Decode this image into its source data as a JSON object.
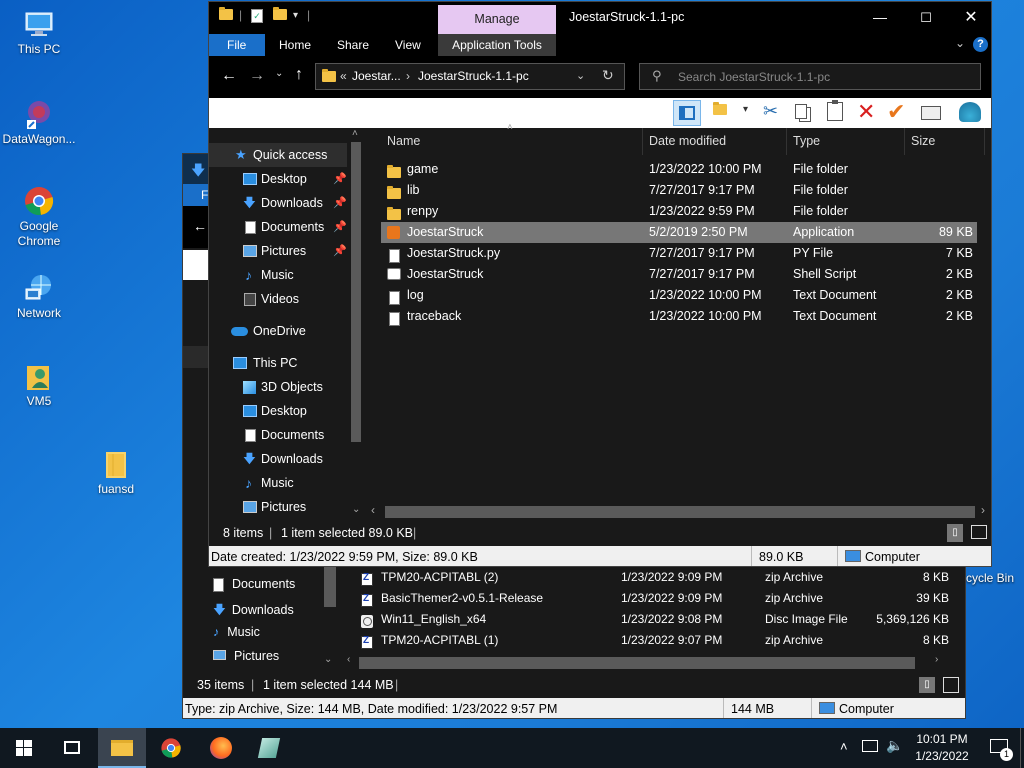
{
  "desktop": {
    "icons": [
      {
        "label": "This PC"
      },
      {
        "label": "DataWagon..."
      },
      {
        "label": "Google Chrome"
      },
      {
        "label": "Network"
      },
      {
        "label": "VM5"
      },
      {
        "label": "fuansd"
      }
    ],
    "recycle_bin_partial": "cycle Bin"
  },
  "back_window": {
    "nav_items": [
      "Documents",
      "Downloads",
      "Music",
      "Pictures"
    ],
    "files": [
      {
        "name": "TPM20-ACPITABL (2)",
        "date": "1/23/2022 9:09 PM",
        "type": "zip Archive",
        "size": "8 KB"
      },
      {
        "name": "BasicThemer2-v0.5.1-Release",
        "date": "1/23/2022 9:09 PM",
        "type": "zip Archive",
        "size": "39 KB"
      },
      {
        "name": "Win11_English_x64",
        "date": "1/23/2022 9:08 PM",
        "type": "Disc Image File",
        "size": "5,369,126 KB"
      },
      {
        "name": "TPM20-ACPITABL (1)",
        "date": "1/23/2022 9:07 PM",
        "type": "zip Archive",
        "size": "8 KB"
      }
    ],
    "status": {
      "count": "35 items",
      "selected": "1 item selected  144 MB"
    },
    "details": {
      "text": "Type: zip Archive, Size: 144 MB, Date modified: 1/23/2022 9:57 PM",
      "size": "144 MB",
      "location": "Computer"
    },
    "tab_partial": "F"
  },
  "front_window": {
    "title": "JoestarStruck-1.1-pc",
    "manage_label": "Manage",
    "tabs": {
      "file": "File",
      "home": "Home",
      "share": "Share",
      "view": "View",
      "app_tools": "Application Tools"
    },
    "address": {
      "prefix": "«",
      "crumb1": "Joestar...",
      "crumb2": "JoestarStruck-1.1-pc"
    },
    "search_placeholder": "Search JoestarStruck-1.1-pc",
    "nav": {
      "quick_access": "Quick access",
      "quick_items": [
        "Desktop",
        "Downloads",
        "Documents",
        "Pictures",
        "Music",
        "Videos"
      ],
      "onedrive": "OneDrive",
      "this_pc": "This PC",
      "pc_items": [
        "3D Objects",
        "Desktop",
        "Documents",
        "Downloads",
        "Music",
        "Pictures"
      ]
    },
    "columns": {
      "name": "Name",
      "date": "Date modified",
      "type": "Type",
      "size": "Size"
    },
    "files": [
      {
        "name": "game",
        "date": "1/23/2022 10:00 PM",
        "type": "File folder",
        "size": "",
        "icon": "folder-icon"
      },
      {
        "name": "lib",
        "date": "7/27/2017 9:17 PM",
        "type": "File folder",
        "size": "",
        "icon": "folder-icon"
      },
      {
        "name": "renpy",
        "date": "1/23/2022 9:59 PM",
        "type": "File folder",
        "size": "",
        "icon": "folder-icon"
      },
      {
        "name": "JoestarStruck",
        "date": "5/2/2019 2:50 PM",
        "type": "Application",
        "size": "89 KB",
        "icon": "app-icon"
      },
      {
        "name": "JoestarStruck.py",
        "date": "7/27/2017 9:17 PM",
        "type": "PY File",
        "size": "7 KB",
        "icon": "file-icon"
      },
      {
        "name": "JoestarStruck",
        "date": "7/27/2017 9:17 PM",
        "type": "Shell Script",
        "size": "2 KB",
        "icon": "script-icon"
      },
      {
        "name": "log",
        "date": "1/23/2022 10:00 PM",
        "type": "Text Document",
        "size": "2 KB",
        "icon": "text-icon"
      },
      {
        "name": "traceback",
        "date": "1/23/2022 10:00 PM",
        "type": "Text Document",
        "size": "2 KB",
        "icon": "text-icon"
      }
    ],
    "selected_index": 3,
    "status": {
      "count": "8 items",
      "selected": "1 item selected  89.0 KB"
    },
    "details": {
      "text": "Date created: 1/23/2022 9:59 PM, Size: 89.0 KB",
      "size": "89.0 KB",
      "location": "Computer"
    }
  },
  "taskbar": {
    "time": "10:01 PM",
    "date": "1/23/2022",
    "notification_count": "1"
  },
  "colors": {
    "accent": "#0078d7",
    "manage_tab": "#e6c8f2",
    "selected_row": "#777777",
    "desktop": "#1e86e0"
  }
}
